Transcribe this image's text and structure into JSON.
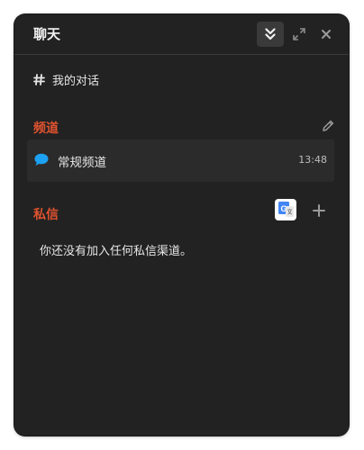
{
  "header": {
    "title": "聊天",
    "buttons": [
      {
        "icon": "double-chevron-down-icon"
      },
      {
        "icon": "expand-icon"
      },
      {
        "icon": "close-icon"
      }
    ]
  },
  "my_conversations": {
    "icon": "grid-hash-icon",
    "label": "我的对话"
  },
  "channels": {
    "title": "频道",
    "edit_icon": "pencil-icon",
    "items": [
      {
        "icon": "speech-bubble-icon",
        "name": "常规频道",
        "time": "13:48"
      }
    ]
  },
  "direct_messages": {
    "title": "私信",
    "translate_icon": "google-translate-icon",
    "add_icon": "plus-icon",
    "empty_text": "你还没有加入任何私信渠道。"
  },
  "colors": {
    "background": "#222222",
    "section_accent": "#e0532f",
    "bubble_icon": "#1da1f2",
    "text": "#e6e6e6"
  }
}
